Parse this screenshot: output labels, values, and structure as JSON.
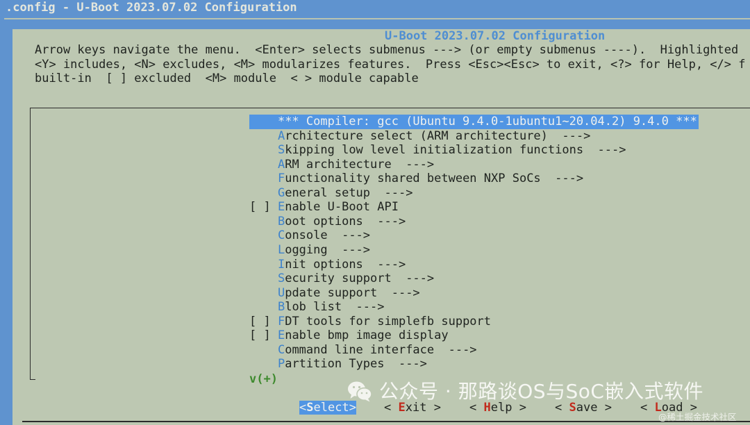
{
  "window": {
    "title": ".config - U-Boot 2023.07.02 Configuration"
  },
  "dialog": {
    "title": "U-Boot 2023.07.02 Configuration",
    "help": [
      "Arrow keys navigate the menu.  <Enter> selects submenus ---> (or empty submenus ----).  Highlighted",
      "<Y> includes, <N> excludes, <M> modularizes features.  Press <Esc><Esc> to exit, <?> for Help, </> f",
      "built-in  [ ] excluded  <M> module  < > module capable"
    ]
  },
  "menu": {
    "items": [
      {
        "prefix": "    ",
        "hot": "",
        "rest": "*** Compiler: gcc (Ubuntu 9.4.0-1ubuntu1~20.04.2) 9.4.0 ***",
        "selected": true
      },
      {
        "prefix": "    ",
        "hot": "A",
        "rest": "rchitecture select (ARM architecture)  --->"
      },
      {
        "prefix": "    ",
        "hot": "S",
        "rest": "kipping low level initialization functions  --->"
      },
      {
        "prefix": "    ",
        "hot": "A",
        "rest": "RM architecture  --->"
      },
      {
        "prefix": "    ",
        "hot": "F",
        "rest": "unctionality shared between NXP SoCs  --->"
      },
      {
        "prefix": "    ",
        "hot": "G",
        "rest": "eneral setup  --->"
      },
      {
        "prefix": "[ ] ",
        "hot": "E",
        "rest": "nable U-Boot API"
      },
      {
        "prefix": "    ",
        "hot": "B",
        "rest": "oot options  --->"
      },
      {
        "prefix": "    ",
        "hot": "C",
        "rest": "onsole  --->"
      },
      {
        "prefix": "    ",
        "hot": "L",
        "rest": "ogging  --->"
      },
      {
        "prefix": "    ",
        "hot": "I",
        "rest": "nit options  --->"
      },
      {
        "prefix": "    ",
        "hot": "S",
        "rest": "ecurity support  --->"
      },
      {
        "prefix": "    ",
        "hot": "U",
        "rest": "pdate support  --->"
      },
      {
        "prefix": "    ",
        "hot": "B",
        "rest": "lob list  --->"
      },
      {
        "prefix": "[ ] ",
        "hot": "F",
        "rest": "DT tools for simplefb support"
      },
      {
        "prefix": "[ ] ",
        "hot": "E",
        "rest": "nable bmp image display"
      },
      {
        "prefix": "    ",
        "hot": "C",
        "rest": "ommand line interface  --->"
      },
      {
        "prefix": "    ",
        "hot": "P",
        "rest": "artition Types  --->"
      }
    ],
    "more_indicator": "v(+)"
  },
  "buttons": [
    {
      "hot": "S",
      "rest": "elect",
      "selected": true
    },
    {
      "hot": "E",
      "rest": "xit"
    },
    {
      "hot": "H",
      "rest": "elp"
    },
    {
      "hot": "S",
      "rest": "ave"
    },
    {
      "hot": "L",
      "rest": "oad"
    }
  ],
  "watermark": {
    "text": "公众号 · 那路谈OS与SoC嵌入式软件",
    "source": "@稀土掘金技术社区"
  },
  "colors": {
    "terminal_bg": "#5f93cf",
    "dialog_bg": "#bdc8b2",
    "highlight": "#5195e3",
    "hotkey": "#3d82cc",
    "button_hotkey": "#c22a1c"
  }
}
